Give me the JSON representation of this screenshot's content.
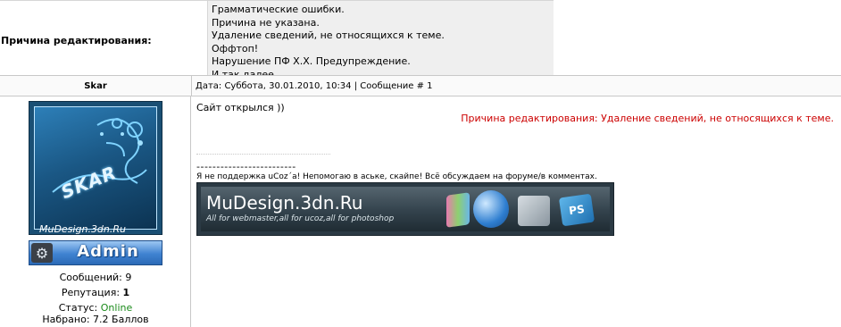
{
  "edit_reason": {
    "label": "Причина редактирования:",
    "options": [
      "Грамматические ошибки.",
      "Причина не указана.",
      "Удаление сведений, не относящихся к теме.",
      "Оффтоп!",
      "Нарушение ПФ Х.Х. Предупреждение.",
      "И так далее"
    ]
  },
  "post": {
    "author": "Skar",
    "meta": "Дата: Суббота, 30.01.2010, 10:34 | Сообщение # 1",
    "message": "Сайт открылся ))",
    "edit_note": "Причина редактирования: Удаление сведений, не относящихся к теме.",
    "signature_line": "-------------------------",
    "signature_text": "Я не поддержка uCoz´a! Непомогаю в аське, скайпе! Всё обсуждаем на форуме/в комментах.",
    "banner_title": "MuDesign.3dn.Ru",
    "banner_subtitle": "All for webmaster,all for ucoz,all for photoshop",
    "banner_ps_label": "PS"
  },
  "user": {
    "avatar_word": "SKAR",
    "avatar_site": "MuDesign.3dn.Ru",
    "rank": "Admin",
    "messages_label": "Сообщений:",
    "messages_value": "9",
    "reputation_label": "Репутация:",
    "reputation_value": "1",
    "status_label": "Статус:",
    "status_value": "Online",
    "points_label": "Набрано:",
    "points_value": "7.2 Баллов"
  },
  "colors": {
    "edit_note": "#cc0000",
    "online": "#1a8a1a",
    "rank_badge": "#3f82d1"
  },
  "icons": [
    "gear-icon",
    "book-icon",
    "phone-icon",
    "cd-icon",
    "photoshop-icon"
  ]
}
